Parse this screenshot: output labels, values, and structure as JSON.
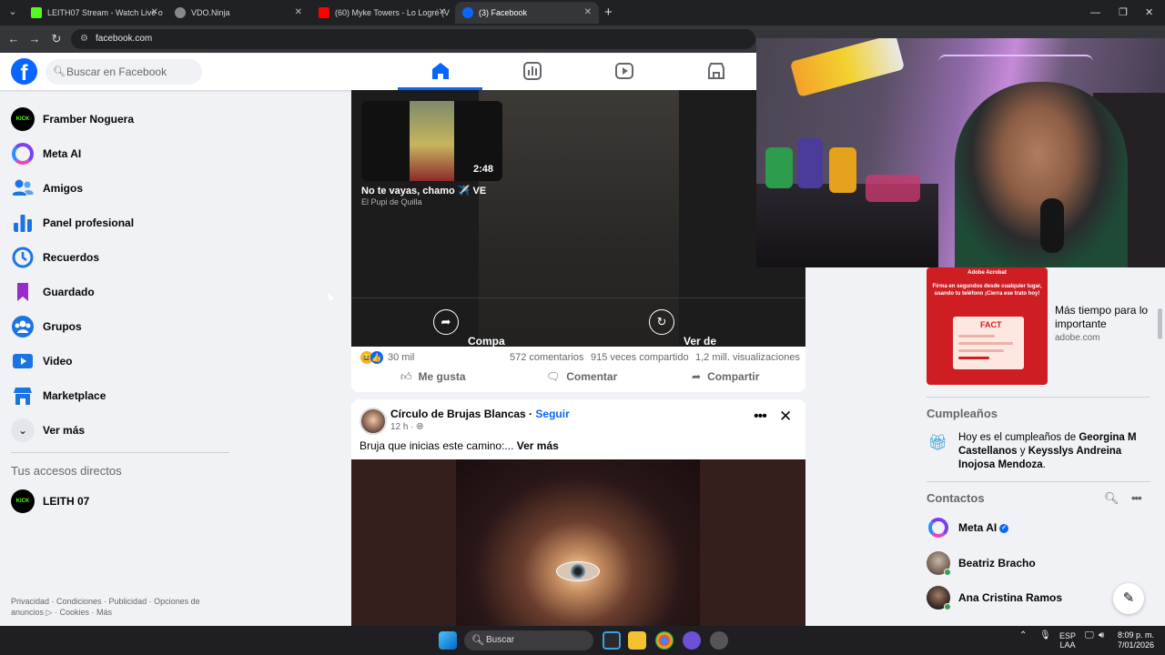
{
  "browser": {
    "tabs": [
      {
        "title": "LEITH07 Stream - Watch Live o",
        "favicon_color": "#53fc18"
      },
      {
        "title": "VDO.Ninja",
        "favicon_color": "#888888"
      },
      {
        "title": "(60) Myke Towers - Lo Logré (V",
        "favicon_color": "#ff0000"
      },
      {
        "title": "(3) Facebook",
        "favicon_color": "#0866ff"
      }
    ],
    "active_tab": 3,
    "new_tab_label": "+",
    "url": "facebook.com"
  },
  "facebook": {
    "logo_letter": "f",
    "search_placeholder": "Buscar en Facebook",
    "brand_color": "#0866ff"
  },
  "left_nav": {
    "items": [
      {
        "label": "Framber Noguera",
        "icon": "kick-avatar",
        "icon_text": "KICK"
      },
      {
        "label": "Meta AI",
        "icon": "meta-ai-icon"
      },
      {
        "label": "Amigos",
        "icon": "friends-icon"
      },
      {
        "label": "Panel profesional",
        "icon": "dashboard-icon"
      },
      {
        "label": "Recuerdos",
        "icon": "memories-icon"
      },
      {
        "label": "Guardado",
        "icon": "bookmark-icon"
      },
      {
        "label": "Grupos",
        "icon": "groups-icon"
      },
      {
        "label": "Video",
        "icon": "video-icon"
      },
      {
        "label": "Marketplace",
        "icon": "marketplace-icon"
      },
      {
        "label": "Ver más",
        "icon": "chevron-down-icon"
      }
    ],
    "shortcuts_title": "Tus accesos directos",
    "shortcuts": [
      {
        "label": "LEITH 07",
        "icon_text": "KICK"
      }
    ],
    "footer": "Privacidad · Condiciones · Publicidad · Opciones de anuncios ▷ · Cookies · Más"
  },
  "post_video": {
    "thumb_duration": "2:48",
    "video_title": "No te vayas, chamo ✈️ VE",
    "video_channel": "El Pupi de Quilla",
    "share_label": "Compa\nrtir",
    "replay_label": "Ver de\nnuevo",
    "reactions": "30 mil",
    "comments": "572 comentarios",
    "shares": "915 veces compartido",
    "views": "1,2 mill. visualizaciones",
    "like_label": "Me gusta",
    "comment_label": "Comentar",
    "share_action_label": "Compartir"
  },
  "post_2": {
    "author": "Círculo de Brujas Blancas",
    "separator": " · ",
    "follow_label": "Seguir",
    "time": "12 h · ",
    "text": "Bruja que inicias este camino:... ",
    "see_more": "Ver más"
  },
  "sponsored": {
    "ad_brand": "Adobe Acrobat",
    "ad_image_text": "Firma en segundos desde cualquier lugar, usando tu teléfono ¡Cierra ese trato hoy!",
    "ad_doc_label": "FACT",
    "title": "Más tiempo para lo importante",
    "domain": "adobe.com"
  },
  "birthdays": {
    "title": "Cumpleaños",
    "prefix": "Hoy es el cumpleaños de ",
    "name1": "Georgina M Castellanos",
    "join": " y ",
    "name2": "Keysslys Andreina Inojosa Mendoza",
    "suffix": "."
  },
  "contacts": {
    "title": "Contactos",
    "items": [
      {
        "name": "Meta AI",
        "verified": true
      },
      {
        "name": "Beatriz Bracho",
        "online": true
      },
      {
        "name": "Ana Cristina Ramos",
        "online": true
      }
    ]
  },
  "taskbar": {
    "search_label": "Buscar",
    "lang_top": "ESP",
    "lang_bottom": "LAA",
    "time": "8:09 p. m.",
    "date": "7/01/2026"
  }
}
